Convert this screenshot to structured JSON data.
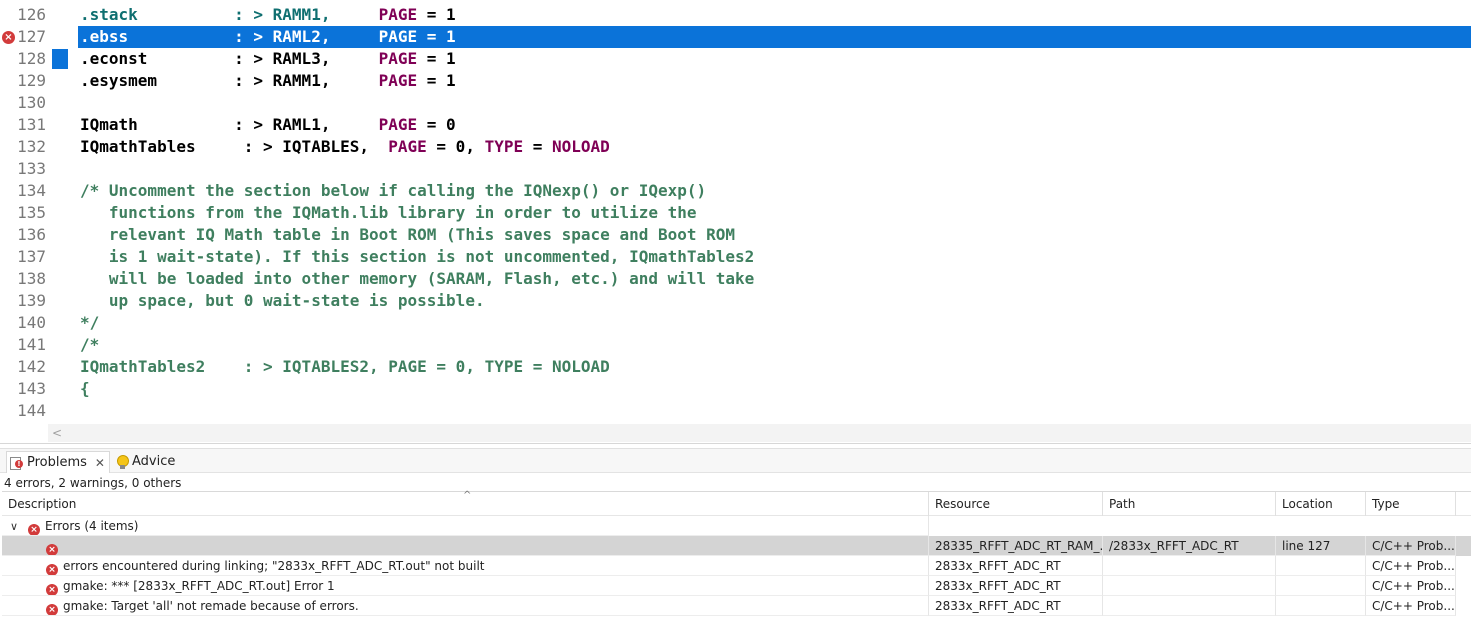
{
  "editor": {
    "lines": [
      {
        "no": "126",
        "parts": [
          {
            "t": ".stack          : > RAMM1,     ",
            "c": "teal"
          },
          {
            "t": "PAGE",
            "c": "purple"
          },
          {
            "t": " = 1",
            "c": ""
          }
        ]
      },
      {
        "no": "127",
        "error": true,
        "selected": true,
        "parts": [
          {
            "t": ".ebss           : > RAML2,     PAGE = 1",
            "c": ""
          }
        ]
      },
      {
        "no": "128",
        "blue": true,
        "parts": [
          {
            "t": ".econst         : > RAML3,     ",
            "c": ""
          },
          {
            "t": "PAGE",
            "c": "purple"
          },
          {
            "t": " = 1",
            "c": ""
          }
        ]
      },
      {
        "no": "129",
        "parts": [
          {
            "t": ".esysmem        : > RAMM1,     ",
            "c": ""
          },
          {
            "t": "PAGE",
            "c": "purple"
          },
          {
            "t": " = 1",
            "c": ""
          }
        ]
      },
      {
        "no": "130",
        "parts": []
      },
      {
        "no": "131",
        "parts": [
          {
            "t": "IQmath          : > RAML1,     ",
            "c": ""
          },
          {
            "t": "PAGE",
            "c": "purple"
          },
          {
            "t": " = 0",
            "c": ""
          }
        ]
      },
      {
        "no": "132",
        "parts": [
          {
            "t": "IQmathTables     : > IQTABLES,  ",
            "c": ""
          },
          {
            "t": "PAGE",
            "c": "purple"
          },
          {
            "t": " = 0, ",
            "c": ""
          },
          {
            "t": "TYPE",
            "c": "purple"
          },
          {
            "t": " = ",
            "c": ""
          },
          {
            "t": "NOLOAD",
            "c": "purple"
          }
        ]
      },
      {
        "no": "133",
        "parts": []
      },
      {
        "no": "134",
        "parts": [
          {
            "t": "/* Uncomment the section below if calling the IQNexp() or IQexp()",
            "c": "comment"
          }
        ]
      },
      {
        "no": "135",
        "parts": [
          {
            "t": "   functions from the IQMath.lib library in order to utilize the",
            "c": "comment"
          }
        ]
      },
      {
        "no": "136",
        "parts": [
          {
            "t": "   relevant IQ Math table in Boot ROM (This saves space and Boot ROM",
            "c": "comment"
          }
        ]
      },
      {
        "no": "137",
        "parts": [
          {
            "t": "   is 1 wait-state). If this section is not uncommented, IQmathTables2",
            "c": "comment"
          }
        ]
      },
      {
        "no": "138",
        "parts": [
          {
            "t": "   will be loaded into other memory (SARAM, Flash, etc.) and will take",
            "c": "comment"
          }
        ]
      },
      {
        "no": "139",
        "parts": [
          {
            "t": "   up space, but 0 wait-state is possible.",
            "c": "comment"
          }
        ]
      },
      {
        "no": "140",
        "parts": [
          {
            "t": "*/",
            "c": "comment"
          }
        ]
      },
      {
        "no": "141",
        "parts": [
          {
            "t": "/*",
            "c": "comment"
          }
        ]
      },
      {
        "no": "142",
        "parts": [
          {
            "t": "IQmathTables2    : > IQTABLES2, PAGE = 0, TYPE = NOLOAD",
            "c": "comment"
          }
        ]
      },
      {
        "no": "143",
        "parts": [
          {
            "t": "{",
            "c": "comment"
          }
        ]
      },
      {
        "no": "144",
        "parts": []
      }
    ],
    "scroll_arrow": "<"
  },
  "panel": {
    "tabs": [
      {
        "label": "Problems",
        "close": "✕"
      },
      {
        "label": "Advice"
      }
    ],
    "summary": "4 errors, 2 warnings, 0 others",
    "sort_caret": "^",
    "columns": [
      "Description",
      "Resource",
      "Path",
      "Location",
      "Type"
    ],
    "group": {
      "chevron": "∨",
      "label": "Errors (4 items)"
    },
    "rows": [
      {
        "description": "",
        "resource": "28335_RFFT_ADC_RT_RAM_...",
        "path": "/2833x_RFFT_ADC_RT",
        "location": "line 127",
        "type": "C/C++ Prob...",
        "selected": true
      },
      {
        "description": "errors encountered during linking; \"2833x_RFFT_ADC_RT.out\" not built",
        "resource": "2833x_RFFT_ADC_RT",
        "path": "",
        "location": "",
        "type": "C/C++ Prob..."
      },
      {
        "description": "gmake: *** [2833x_RFFT_ADC_RT.out] Error 1",
        "resource": "2833x_RFFT_ADC_RT",
        "path": "",
        "location": "",
        "type": "C/C++ Prob..."
      },
      {
        "description": "gmake: Target 'all' not remade because of errors.",
        "resource": "2833x_RFFT_ADC_RT",
        "path": "",
        "location": "",
        "type": "C/C++ Prob..."
      }
    ],
    "error_glyph": "×"
  }
}
